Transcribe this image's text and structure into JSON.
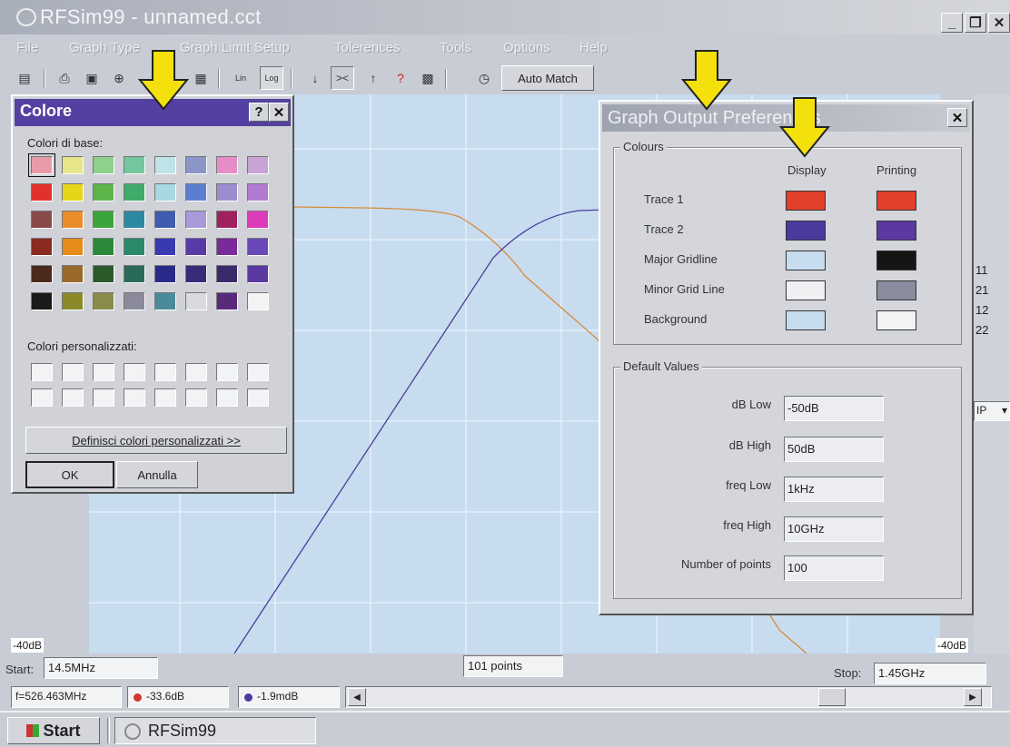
{
  "window": {
    "title": "RFSim99 - unnamed.cct",
    "minimize": "_",
    "maximize": "❐",
    "close": "✕"
  },
  "menu": [
    "File",
    "Graph Type",
    "Graph Limit Setup",
    "Tolerences",
    "Tools",
    "Options",
    "Help"
  ],
  "toolbar": {
    "lin": "Lin",
    "log": "Log",
    "auto_match": "Auto Match"
  },
  "graph": {
    "y_low_left": "-40dB",
    "y_low_right": "-40dB",
    "side_labels": [
      "11",
      "21",
      "12",
      "22"
    ],
    "side_dropdown": "IP",
    "colors": {
      "background": "#c7dcef",
      "trace1": "#d98a3a",
      "trace2": "#4b3e9a"
    }
  },
  "colore": {
    "title": "Colore",
    "help": "?",
    "close": "✕",
    "basic_label": "Colori di base:",
    "custom_label": "Colori personalizzati:",
    "define_button": "Definisci colori personalizzati >>",
    "ok": "OK",
    "cancel": "Annulla",
    "basic_colors": [
      [
        "#e99aa8",
        "#e7e58a",
        "#8fd08a",
        "#73c79e",
        "#bfe3e6",
        "#8c95c8",
        "#e68cc6",
        "#c9a3d6"
      ],
      [
        "#e2312c",
        "#e7d51a",
        "#5db54a",
        "#40ab6a",
        "#a8d9e2",
        "#5a7fd0",
        "#9c8cd0",
        "#b27ad0"
      ],
      [
        "#8a4a4a",
        "#eb8c2a",
        "#3aa53a",
        "#2c8aa0",
        "#3f5cb0",
        "#a89ad8",
        "#a02060",
        "#dc3cb8"
      ],
      [
        "#8a2a20",
        "#e68a1a",
        "#2a8a3a",
        "#2a8a6a",
        "#3a3ab0",
        "#5a3aa8",
        "#7a2a9a",
        "#6a48b8"
      ],
      [
        "#4a2a1a",
        "#9a6a2a",
        "#2a5a2a",
        "#2a6a5a",
        "#2a2a8a",
        "#3a2a7a",
        "#3a2a6a",
        "#5a3aa0"
      ],
      [
        "#1a1a1a",
        "#8a8a2a",
        "#8a8a4a",
        "#8a8a9a",
        "#4a8a9a",
        "#d8dade",
        "#5a2a7a",
        "#f4f4f4"
      ]
    ]
  },
  "prefs": {
    "title": "Graph Output Preferences",
    "close": "✕",
    "colours_group": "Colours",
    "display_header": "Display",
    "printing_header": "Printing",
    "rows": [
      {
        "label": "Trace 1",
        "display": "#e2402a",
        "printing": "#e2402a"
      },
      {
        "label": "Trace 2",
        "display": "#4a3a9e",
        "printing": "#5a3aa0"
      },
      {
        "label": "Major Gridline",
        "display": "#c7dcef",
        "printing": "#151515"
      },
      {
        "label": "Minor Grid Line",
        "display": "#eef0f2",
        "printing": "#8a8c9e"
      },
      {
        "label": "Background",
        "display": "#c7dcef",
        "printing": "#f2f3f5"
      }
    ],
    "defaults_group": "Default Values",
    "fields": [
      {
        "label": "dB Low",
        "value": "-50dB"
      },
      {
        "label": "dB High",
        "value": "50dB"
      },
      {
        "label": "freq Low",
        "value": "1kHz"
      },
      {
        "label": "freq High",
        "value": "10GHz"
      },
      {
        "label": "Number of points",
        "value": "100"
      }
    ]
  },
  "status": {
    "start_label": "Start:",
    "start_value": "14.5MHz",
    "points": "101 points",
    "stop_label": "Stop:",
    "stop_value": "1.45GHz",
    "freq": "f=526.463MHz",
    "trace1_value": "-33.6dB",
    "trace2_value": "-1.9mdB"
  },
  "taskbar": {
    "start": "Start",
    "task": "RFSim99"
  },
  "accent": {
    "arrow": "#f4e10c",
    "active_title": "#5440a0"
  }
}
